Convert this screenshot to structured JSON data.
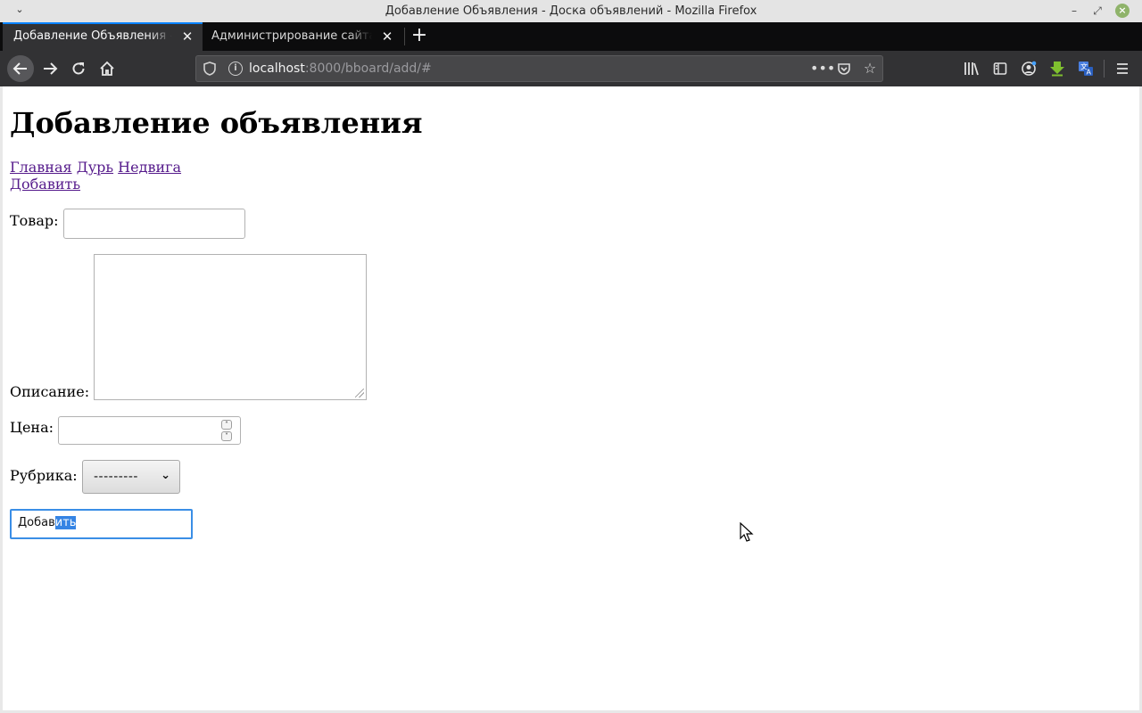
{
  "window": {
    "title": "Добавление Объявления - Доска объявлений - Mozilla Firefox"
  },
  "tabs": [
    {
      "label": "Добавление Объявления – Доска объявлений",
      "active": true
    },
    {
      "label": "Администрирование сайта | Django",
      "active": false
    }
  ],
  "urlbar": {
    "host": "localhost",
    "rest": ":8000/bboard/add/#"
  },
  "page": {
    "heading": "Добавление объявления",
    "nav_links": [
      "Главная",
      "Дурь",
      "Недвига",
      "Добавить"
    ],
    "form": {
      "title_label": "Товар:",
      "title_value": "",
      "content_label": "Описание:",
      "content_value": "",
      "price_label": "Цена:",
      "price_value": "",
      "rubric_label": "Рубрика:",
      "rubric_selected": "---------",
      "submit_text_plain": "Добав",
      "submit_text_selected": "ить"
    }
  },
  "icons": {
    "back": "back-arrow-icon",
    "forward": "forward-arrow-icon",
    "reload": "reload-icon",
    "home": "home-icon",
    "library": "library-icon",
    "sidebar": "sidebar-icon",
    "account": "account-icon",
    "download": "download-extension-icon",
    "translate": "translate-extension-icon",
    "menu": "hamburger-menu-icon"
  },
  "colors": {
    "accent": "#0a84ff",
    "visited_link": "#551a8b",
    "selection": "#3584e4",
    "download_icon": "#7fbf2f"
  }
}
